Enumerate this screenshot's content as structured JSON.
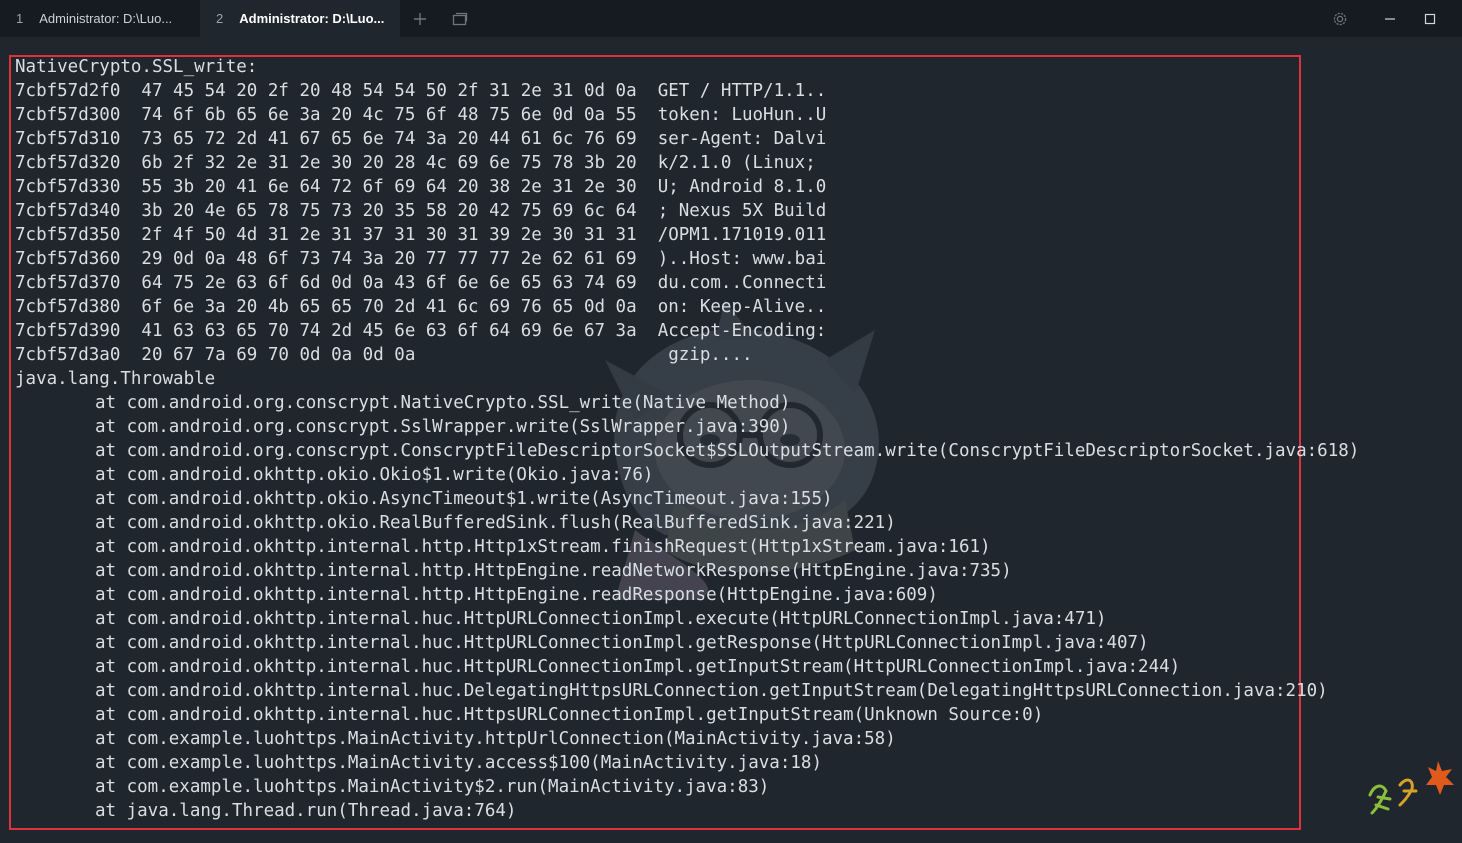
{
  "tabs": [
    {
      "number": "1",
      "title": "Administrator: D:\\Luo..."
    },
    {
      "number": "2",
      "title": "Administrator: D:\\Luo..."
    }
  ],
  "terminal": {
    "header": "NativeCrypto.SSL_write:",
    "hexdump": [
      "7cbf57d2f0  47 45 54 20 2f 20 48 54 54 50 2f 31 2e 31 0d 0a  GET / HTTP/1.1..",
      "7cbf57d300  74 6f 6b 65 6e 3a 20 4c 75 6f 48 75 6e 0d 0a 55  token: LuoHun..U",
      "7cbf57d310  73 65 72 2d 41 67 65 6e 74 3a 20 44 61 6c 76 69  ser-Agent: Dalvi",
      "7cbf57d320  6b 2f 32 2e 31 2e 30 20 28 4c 69 6e 75 78 3b 20  k/2.1.0 (Linux;",
      "7cbf57d330  55 3b 20 41 6e 64 72 6f 69 64 20 38 2e 31 2e 30  U; Android 8.1.0",
      "7cbf57d340  3b 20 4e 65 78 75 73 20 35 58 20 42 75 69 6c 64  ; Nexus 5X Build",
      "7cbf57d350  2f 4f 50 4d 31 2e 31 37 31 30 31 39 2e 30 31 31  /OPM1.171019.011",
      "7cbf57d360  29 0d 0a 48 6f 73 74 3a 20 77 77 77 2e 62 61 69  )..Host: www.bai",
      "7cbf57d370  64 75 2e 63 6f 6d 0d 0a 43 6f 6e 6e 65 63 74 69  du.com..Connecti",
      "7cbf57d380  6f 6e 3a 20 4b 65 65 70 2d 41 6c 69 76 65 0d 0a  on: Keep-Alive..",
      "7cbf57d390  41 63 63 65 70 74 2d 45 6e 63 6f 64 69 6e 67 3a  Accept-Encoding:",
      "7cbf57d3a0  20 67 7a 69 70 0d 0a 0d 0a                        gzip...."
    ],
    "exception": "java.lang.Throwable",
    "stack": [
      "at com.android.org.conscrypt.NativeCrypto.SSL_write(Native Method)",
      "at com.android.org.conscrypt.SslWrapper.write(SslWrapper.java:390)",
      "at com.android.org.conscrypt.ConscryptFileDescriptorSocket$SSLOutputStream.write(ConscryptFileDescriptorSocket.java:618)",
      "at com.android.okhttp.okio.Okio$1.write(Okio.java:76)",
      "at com.android.okhttp.okio.AsyncTimeout$1.write(AsyncTimeout.java:155)",
      "at com.android.okhttp.okio.RealBufferedSink.flush(RealBufferedSink.java:221)",
      "at com.android.okhttp.internal.http.Http1xStream.finishRequest(Http1xStream.java:161)",
      "at com.android.okhttp.internal.http.HttpEngine.readNetworkResponse(HttpEngine.java:735)",
      "at com.android.okhttp.internal.http.HttpEngine.readResponse(HttpEngine.java:609)",
      "at com.android.okhttp.internal.huc.HttpURLConnectionImpl.execute(HttpURLConnectionImpl.java:471)",
      "at com.android.okhttp.internal.huc.HttpURLConnectionImpl.getResponse(HttpURLConnectionImpl.java:407)",
      "at com.android.okhttp.internal.huc.HttpURLConnectionImpl.getInputStream(HttpURLConnectionImpl.java:244)",
      "at com.android.okhttp.internal.huc.DelegatingHttpsURLConnection.getInputStream(DelegatingHttpsURLConnection.java:210)",
      "at com.android.okhttp.internal.huc.HttpsURLConnectionImpl.getInputStream(Unknown Source:0)",
      "at com.example.luohttps.MainActivity.httpUrlConnection(MainActivity.java:58)",
      "at com.example.luohttps.MainActivity.access$100(MainActivity.java:18)",
      "at com.example.luohttps.MainActivity$2.run(MainActivity.java:83)",
      "at java.lang.Thread.run(Thread.java:764)"
    ]
  },
  "colors": {
    "background": "#1f262d",
    "titlebar": "#151b21",
    "text": "#d8dee4",
    "highlight_border": "#e0303a"
  },
  "icons": [
    "new-tab-icon",
    "tab-switcher-icon",
    "settings-gear-icon",
    "minimize-icon",
    "maximize-icon",
    "anime-character-wallpaper",
    "corner-logo"
  ]
}
